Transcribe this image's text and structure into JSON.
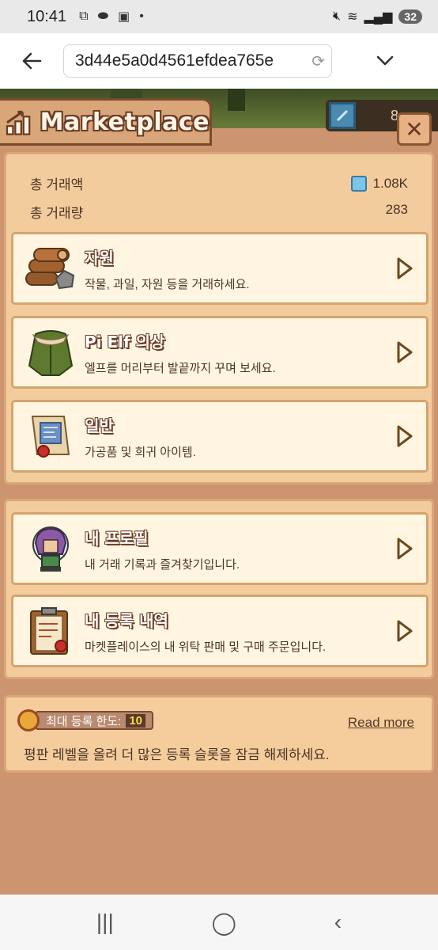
{
  "status_bar": {
    "time": "10:41",
    "battery": "32"
  },
  "browser": {
    "url": "3d44e5a0d4561efdea765e"
  },
  "game": {
    "title": "Marketplace",
    "currency_value": "8",
    "stats": {
      "total_volume_label": "총 거래액",
      "total_volume_value": "1.08K",
      "total_count_label": "총 거래량",
      "total_count_value": "283"
    },
    "categories": [
      {
        "title": "자원",
        "desc": "작물, 과일, 자원 등을 거래하세요.",
        "icon": "logs-icon"
      },
      {
        "title": "Pi Elf 의상",
        "desc": "엘프를 머리부터 발끝까지 꾸며 보세요.",
        "icon": "coat-icon"
      },
      {
        "title": "일반",
        "desc": "가공품 및 희귀 아이템.",
        "icon": "scroll-icon"
      }
    ],
    "personal": [
      {
        "title": "내 프로필",
        "desc": "내 거래 기록과 즐겨찾기입니다.",
        "icon": "elf-avatar-icon"
      },
      {
        "title": "내 등록 내역",
        "desc": "마켓플레이스의 내 위탁 판매 및 구매 주문입니다.",
        "icon": "clipboard-icon"
      }
    ],
    "limit": {
      "label": "최대 등록 한도:",
      "value": "10",
      "read_more": "Read more",
      "desc": "평판 레벨을 올려 더 많은 등록 슬롯을 잠금 해제하세요."
    }
  },
  "colors": {
    "background": "#cd9470",
    "panel": "#f3cc9e",
    "card": "#fff5e0",
    "accent_text": "#6a3a22"
  }
}
